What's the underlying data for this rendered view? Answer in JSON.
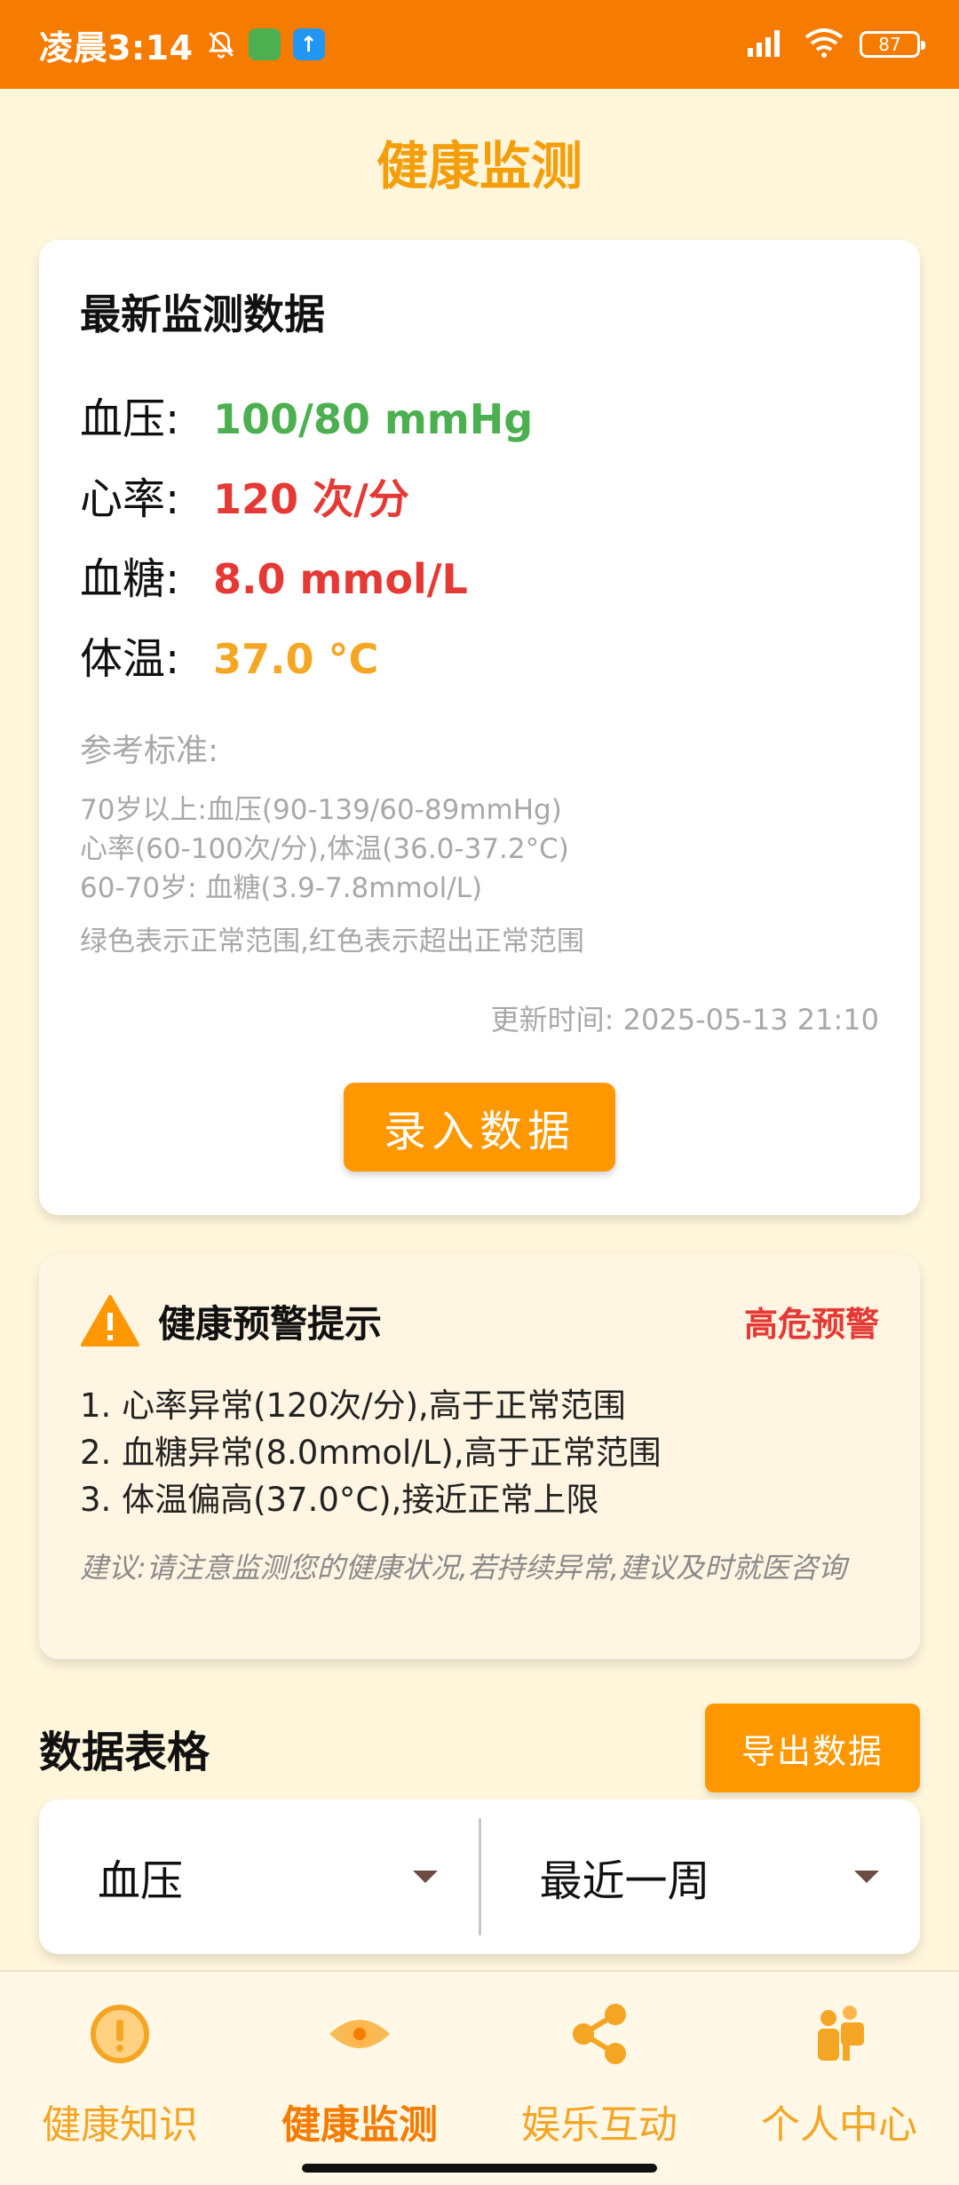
{
  "status_bar": {
    "time": "凌晨3:14",
    "battery": "87"
  },
  "header": {
    "title": "健康监测"
  },
  "latest": {
    "heading": "最新监测数据",
    "metrics": [
      {
        "label": "血压:",
        "value": "100/80 mmHg",
        "color": "#4CAF50"
      },
      {
        "label": "心率:",
        "value": "120 次/分",
        "color": "#E53935"
      },
      {
        "label": "血糖:",
        "value": "8.0 mmol/L",
        "color": "#E53935"
      },
      {
        "label": "体温:",
        "value": "37.0 °C",
        "color": "#F5A623"
      }
    ],
    "reference_title": "参考标准:",
    "reference_lines": [
      "70岁以上:血压(90-139/60-89mmHg)",
      "心率(60-100次/分),体温(36.0-37.2°C)",
      "60-70岁: 血糖(3.9-7.8mmol/L)"
    ],
    "legend": "绿色表示正常范围,红色表示超出正常范围",
    "update_time": "更新时间: 2025-05-13 21:10",
    "record_button": "录入数据"
  },
  "warning": {
    "title": "健康预警提示",
    "level": "高危预警",
    "items": [
      "1. 心率异常(120次/分),高于正常范围",
      "2. 血糖异常(8.0mmol/L),高于正常范围",
      "3. 体温偏高(37.0°C),接近正常上限"
    ],
    "advice": "建议:请注意监测您的健康状况,若持续异常,建议及时就医咨询"
  },
  "table": {
    "title": "数据表格",
    "export_button": "导出数据",
    "metric_select": "血压",
    "period_select": "最近一周"
  },
  "nav": {
    "items": [
      {
        "label": "健康知识",
        "icon": "info-icon"
      },
      {
        "label": "健康监测",
        "icon": "eye-icon",
        "active": true
      },
      {
        "label": "娱乐互动",
        "icon": "share-icon"
      },
      {
        "label": "个人中心",
        "icon": "people-icon"
      }
    ]
  },
  "colors": {
    "accent": "#FF9800",
    "status_bar": "#F57C00",
    "title": "#F59E0B",
    "danger": "#E53935",
    "normal": "#4CAF50"
  }
}
